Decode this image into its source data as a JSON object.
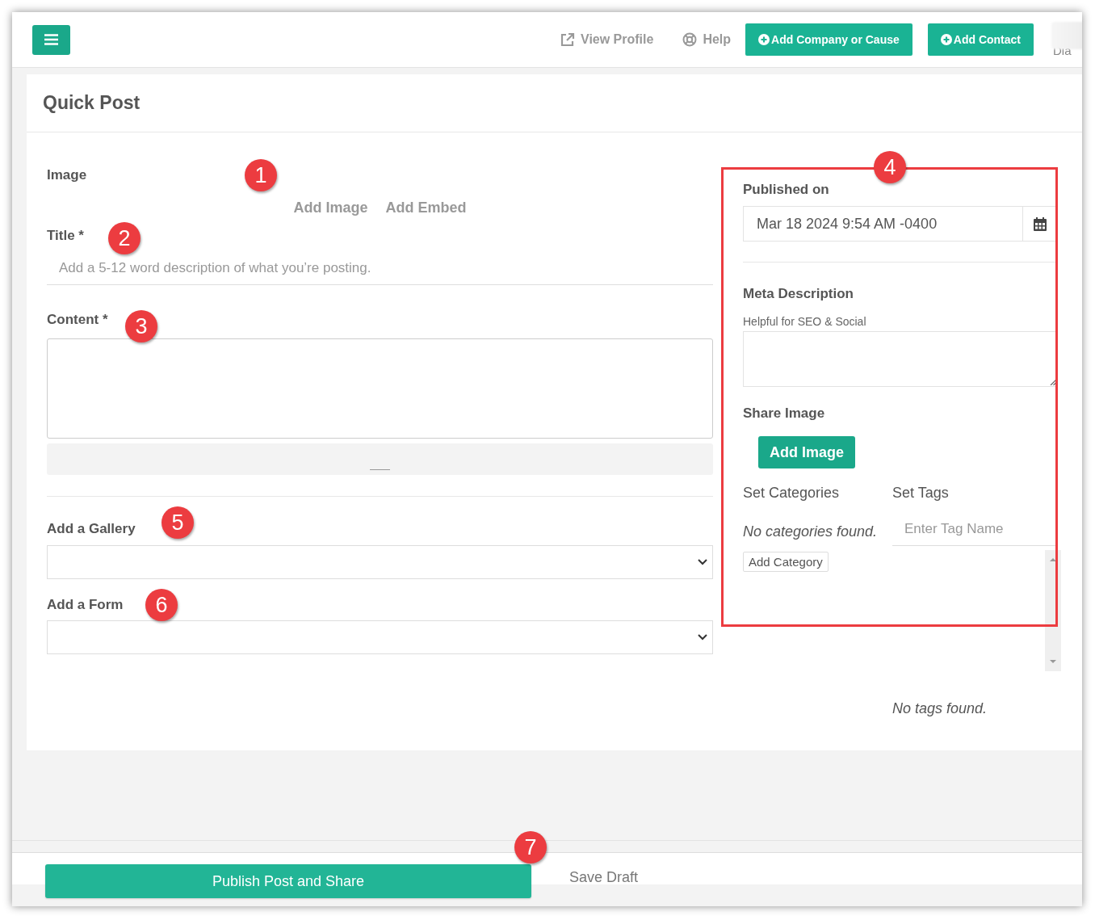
{
  "header": {
    "links": [
      "View Profile",
      "Help"
    ],
    "buttons": [
      "Add Company or Cause",
      "Add Contact"
    ],
    "user_name": "Dia"
  },
  "card": {
    "title": "Quick Post",
    "image": {
      "label": "Image",
      "actions": [
        "Add Image",
        "Add Embed"
      ]
    },
    "title_field": {
      "label": "Title *",
      "placeholder": "Add a 5-12 word description of what you’re posting."
    },
    "content": {
      "label": "Content *"
    },
    "gallery": {
      "label": "Add a Gallery"
    },
    "form": {
      "label": "Add a Form"
    },
    "sidebar": {
      "published_label": "Published on",
      "published_value": "Mar 18 2024 9:54 AM -0400",
      "meta_label": "Meta Description",
      "meta_hint": "Helpful for SEO & Social",
      "share_image_label": "Share Image",
      "share_image_button": "Add Image",
      "categories_label": "Set Categories",
      "categories_empty": "No categories found.",
      "add_category": "Add Category",
      "tags_label": "Set Tags",
      "tag_placeholder": "Enter Tag Name",
      "tags_empty": "No tags found."
    }
  },
  "footer": {
    "publish_button": "Publish Post and Share",
    "save_draft": "Save Draft"
  },
  "annotations": [
    "1",
    "2",
    "3",
    "4",
    "5",
    "6",
    "7"
  ]
}
